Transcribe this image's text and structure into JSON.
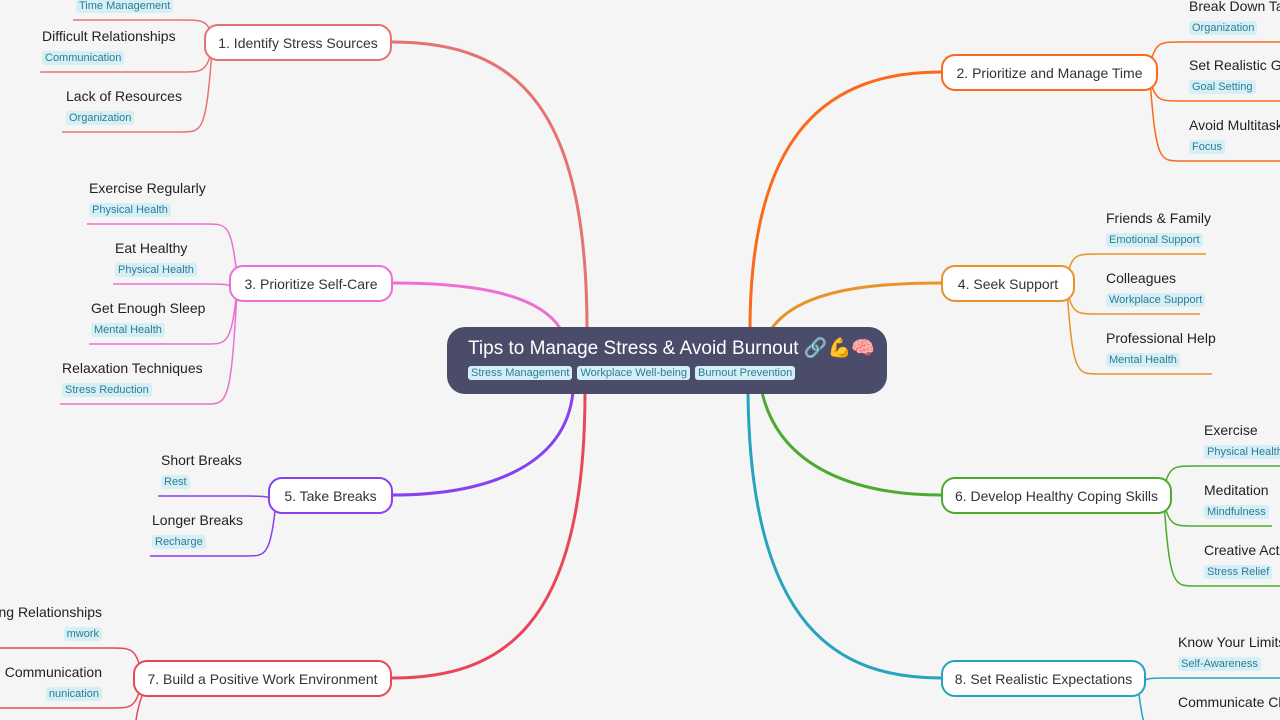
{
  "root": {
    "title": "Tips to Manage Stress & Avoid Burnout",
    "icons": [
      "link-icon",
      "flexed-biceps-emoji",
      "brain-emoji"
    ],
    "emoji": "💪🧠",
    "tags": [
      "Stress Management",
      "Workplace Well-being",
      "Burnout Prevention"
    ],
    "color": "#4a4c6a"
  },
  "branches": [
    {
      "label": "1. Identify Stress Sources",
      "color": "#e57373",
      "leaves": [
        {
          "text": "",
          "tag": "Time Management"
        },
        {
          "text": "Difficult Relationships",
          "tag": "Communication"
        },
        {
          "text": "Lack of Resources",
          "tag": "Organization"
        }
      ]
    },
    {
      "label": "2. Prioritize and Manage Time",
      "color": "#f96a1b",
      "leaves": [
        {
          "text": "Break Down Tas",
          "tag": "Organization"
        },
        {
          "text": "Set Realistic Go",
          "tag": "Goal Setting"
        },
        {
          "text": "Avoid Multitask",
          "tag": "Focus"
        }
      ]
    },
    {
      "label": "3. Prioritize Self-Care",
      "color": "#ee6fd3",
      "leaves": [
        {
          "text": "Exercise Regularly",
          "tag": "Physical Health"
        },
        {
          "text": "Eat Healthy",
          "tag": "Physical Health"
        },
        {
          "text": "Get Enough Sleep",
          "tag": "Mental Health"
        },
        {
          "text": "Relaxation Techniques",
          "tag": "Stress Reduction"
        }
      ]
    },
    {
      "label": "4. Seek Support",
      "color": "#e8922a",
      "leaves": [
        {
          "text": "Friends & Family",
          "tag": "Emotional Support"
        },
        {
          "text": "Colleagues",
          "tag": "Workplace Support"
        },
        {
          "text": "Professional Help",
          "tag": "Mental Health"
        }
      ]
    },
    {
      "label": "5. Take Breaks",
      "color": "#8a3ff0",
      "leaves": [
        {
          "text": "Short Breaks",
          "tag": "Rest"
        },
        {
          "text": "Longer Breaks",
          "tag": "Recharge"
        }
      ]
    },
    {
      "label": "6. Develop Healthy Coping Skills",
      "color": "#4caa2e",
      "leaves": [
        {
          "text": "Exercise",
          "tag": "Physical Health"
        },
        {
          "text": "Meditation",
          "tag": "Mindfulness"
        },
        {
          "text": "Creative Activ",
          "tag": "Stress Relief"
        }
      ]
    },
    {
      "label": "7. Build a Positive Work Environment",
      "color": "#e8475a",
      "leaves": [
        {
          "text": "ong Relationships",
          "tag": "mwork"
        },
        {
          "text": "n Communication",
          "tag": "nunication"
        }
      ]
    },
    {
      "label": "8. Set Realistic Expectations",
      "color": "#26a3bd",
      "leaves": [
        {
          "text": "Know Your Limits",
          "tag": "Self-Awareness"
        },
        {
          "text": "Communicate Cle",
          "tag": ""
        }
      ]
    }
  ]
}
